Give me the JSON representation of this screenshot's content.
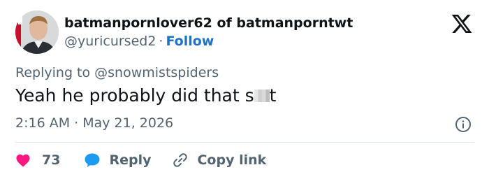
{
  "author": {
    "display_name": "batmanpornlover62 of batmanporntwt",
    "handle": "@yuricursed2",
    "separator": "·",
    "follow_label": "Follow"
  },
  "reply_context": "Replying to @snowmistspiders",
  "tweet": {
    "text_before": "Yeah he probably did that s",
    "text_after": "t"
  },
  "timestamp": "2:16 AM · May 21, 2026",
  "actions": {
    "like_count": "73",
    "reply_label": "Reply",
    "copy_link_label": "Copy link"
  },
  "icons": [
    "x-logo-icon",
    "info-icon",
    "heart-icon",
    "comment-icon",
    "link-icon"
  ],
  "colors": {
    "text": "#0f1419",
    "secondary": "#536471",
    "follow": "#1d74c7",
    "heart": "#f91880",
    "reply_bubble": "#1d9bf0"
  }
}
